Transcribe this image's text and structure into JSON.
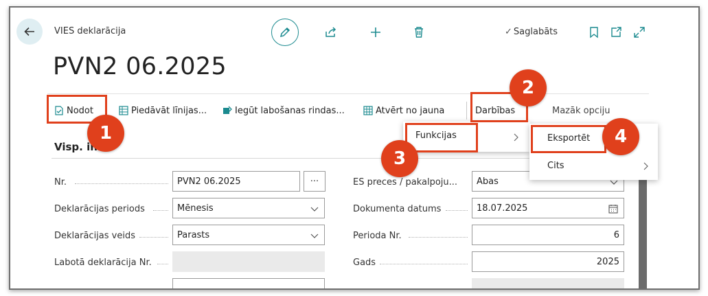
{
  "header": {
    "caption": "VIES deklarācija",
    "title": "PVN2 06.2025",
    "saved_label": "Saglabāts",
    "saved_check": "✓"
  },
  "actions": {
    "submit": "Nodot",
    "suggest_lines": "Piedāvāt līnijas...",
    "get_correction_lines": "Iegūt labošanas rindas...",
    "reopen": "Atvērt no jauna",
    "actions_menu": "Darbības",
    "fewer_options": "Mazāk opciju"
  },
  "submenu": {
    "functions": "Funkcijas",
    "export": "Eksportēt",
    "other": "Cits"
  },
  "section": {
    "title": "Visp. in"
  },
  "fields": {
    "nr_label": "Nr.",
    "nr_value": "PVN2 06.2025",
    "ellipsis": "···",
    "period_label": "Deklarācijas periods",
    "period_value": "Mēnesis",
    "type_label": "Deklarācijas veids",
    "type_value": "Parasts",
    "corrected_label": "Labotā deklarācija Nr.",
    "corrected_value": "",
    "eu_goods_label": "ES preces / pakalpoju...",
    "eu_goods_value": "Abas",
    "doc_date_label": "Dokumenta datums",
    "doc_date_value": "18.07.2025",
    "period_nr_label": "Perioda Nr.",
    "period_nr_value": "6",
    "year_label": "Gads",
    "year_value": "2025"
  },
  "callouts": [
    "1",
    "2",
    "3",
    "4"
  ],
  "colors": {
    "accent": "#1b8a8f",
    "highlight": "#e0401c",
    "back_bg": "#dfeef2"
  },
  "icons": [
    "back-arrow-icon",
    "pencil-icon",
    "share-icon",
    "plus-icon",
    "trash-icon",
    "bookmark-icon",
    "open-new-window-icon",
    "expand-icon",
    "calendar-icon",
    "chevron-down-icon",
    "chevron-right-icon"
  ]
}
